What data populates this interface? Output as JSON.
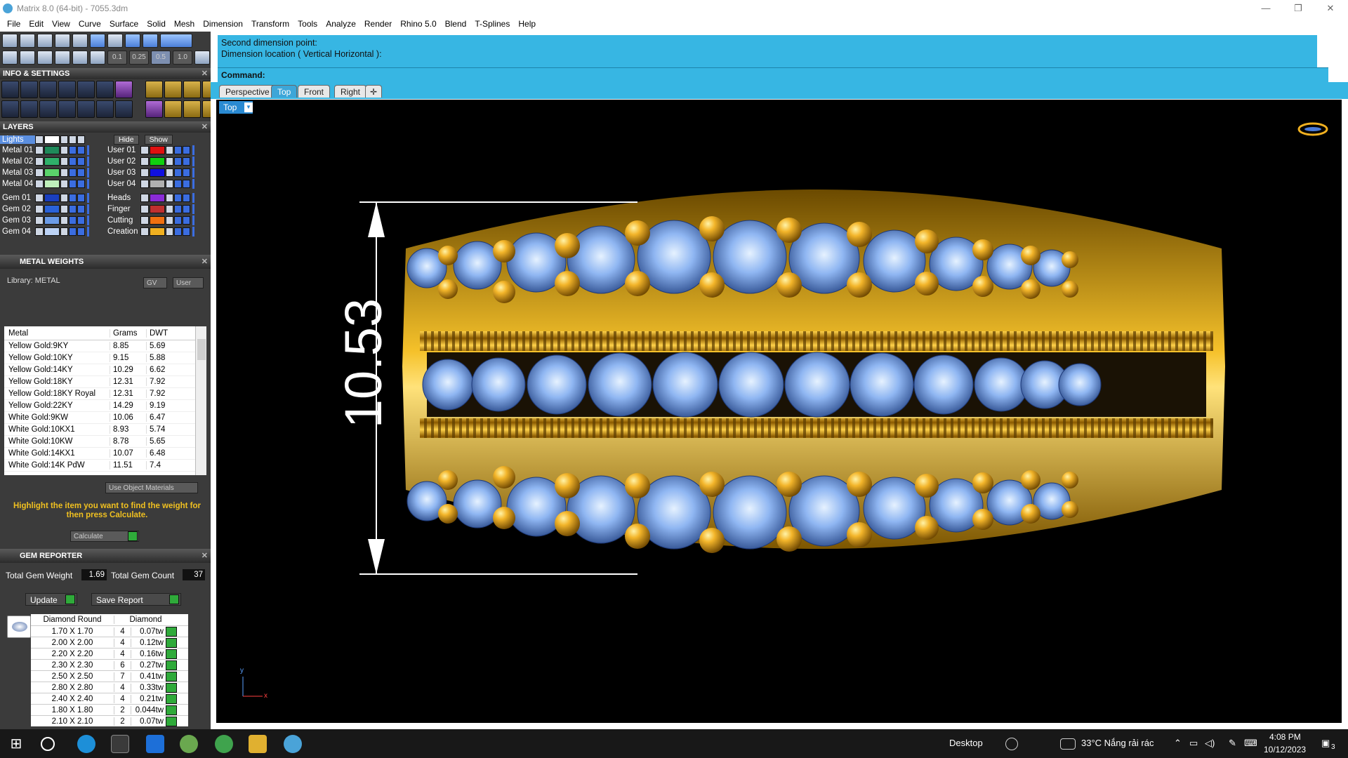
{
  "window": {
    "title": "Matrix 8.0 (64-bit) - 7055.3dm",
    "controls": [
      "—",
      "❐",
      "✕"
    ]
  },
  "menu": [
    "File",
    "Edit",
    "View",
    "Curve",
    "Surface",
    "Solid",
    "Mesh",
    "Dimension",
    "Transform",
    "Tools",
    "Analyze",
    "Render",
    "Rhino 5.0",
    "Blend",
    "T-Splines",
    "Help"
  ],
  "toolbar": {
    "scales": [
      "0.1",
      "0.25",
      "0.5",
      "1.0"
    ]
  },
  "info_settings": {
    "title": "INFO & SETTINGS"
  },
  "layers": {
    "title": "LAYERS",
    "lights_label": "Lights",
    "hide_label": "Hide",
    "show_label": "Show",
    "left": [
      {
        "name": "Metal 01",
        "color": "#1f8a5a"
      },
      {
        "name": "Metal 02",
        "color": "#2fb06a"
      },
      {
        "name": "Metal 03",
        "color": "#5ad36b"
      },
      {
        "name": "Metal 04",
        "color": "#bff0bb"
      },
      {
        "name": "Gem 01",
        "color": "#1a3fbf"
      },
      {
        "name": "Gem 02",
        "color": "#2a62d8"
      },
      {
        "name": "Gem 03",
        "color": "#6b9ce8"
      },
      {
        "name": "Gem 04",
        "color": "#bcd3f5"
      }
    ],
    "right": [
      {
        "name": "User 01",
        "color": "#e01010"
      },
      {
        "name": "User 02",
        "color": "#10d010"
      },
      {
        "name": "User 03",
        "color": "#1010e0"
      },
      {
        "name": "User 04",
        "color": "#b0b0b0"
      },
      {
        "name": "Heads",
        "color": "#8a2bd6"
      },
      {
        "name": "Finger",
        "color": "#c03030"
      },
      {
        "name": "Cutting",
        "color": "#f07010"
      },
      {
        "name": "Creation",
        "color": "#f0b020"
      }
    ]
  },
  "metal_weights": {
    "title": "METAL WEIGHTS",
    "library": "Library: METAL",
    "gv": "GV",
    "user": "User",
    "headers": [
      "Metal",
      "Grams",
      "DWT"
    ],
    "rows": [
      [
        "Yellow Gold:9KY",
        "8.85",
        "5.69"
      ],
      [
        "Yellow Gold:10KY",
        "9.15",
        "5.88"
      ],
      [
        "Yellow Gold:14KY",
        "10.29",
        "6.62"
      ],
      [
        "Yellow Gold:18KY",
        "12.31",
        "7.92"
      ],
      [
        "Yellow Gold:18KY Royal",
        "12.31",
        "7.92"
      ],
      [
        "Yellow Gold:22KY",
        "14.29",
        "9.19"
      ],
      [
        "White Gold:9KW",
        "10.06",
        "6.47"
      ],
      [
        "White Gold:10KX1",
        "8.93",
        "5.74"
      ],
      [
        "White Gold:10KW",
        "8.78",
        "5.65"
      ],
      [
        "White Gold:14KX1",
        "10.07",
        "6.48"
      ],
      [
        "White Gold:14K PdW",
        "11.51",
        "7.4"
      ]
    ],
    "use_object_materials": "Use Object Materials",
    "note": "Highlight the item you want to find the weight for then press Calculate.",
    "calculate": "Calculate"
  },
  "gem_reporter": {
    "title": "GEM REPORTER",
    "total_weight_label": "Total Gem Weight",
    "total_weight": "1.69",
    "total_count_label": "Total Gem Count",
    "total_count": "37",
    "update": "Update",
    "save_report": "Save Report",
    "headers": [
      "Diamond Round",
      "Diamond"
    ],
    "rows": [
      [
        "1.70 X 1.70",
        "4",
        "0.07tw"
      ],
      [
        "2.00 X 2.00",
        "4",
        "0.12tw"
      ],
      [
        "2.20 X 2.20",
        "4",
        "0.16tw"
      ],
      [
        "2.30 X 2.30",
        "6",
        "0.27tw"
      ],
      [
        "2.50 X 2.50",
        "7",
        "0.41tw"
      ],
      [
        "2.80 X 2.80",
        "4",
        "0.33tw"
      ],
      [
        "2.40 X 2.40",
        "4",
        "0.21tw"
      ],
      [
        "1.80 X 1.80",
        "2",
        "0.044tw"
      ],
      [
        "2.10 X 2.10",
        "2",
        "0.07tw"
      ]
    ]
  },
  "command": {
    "line1": "Second dimension point:",
    "line2": "Dimension location ( Vertical  Horizontal ):",
    "prompt": "Command:"
  },
  "viewport_tabs": [
    "Perspective",
    "Top",
    "Front",
    "Right"
  ],
  "viewport": {
    "label": "Top",
    "dimension": "10.53",
    "axis_y": "y",
    "axis_x": "x"
  },
  "taskbar": {
    "desktop": "Desktop",
    "weather": "33°C  Nắng rải rác",
    "time": "4:08 PM",
    "date": "10/12/2023",
    "notifications": "3"
  }
}
